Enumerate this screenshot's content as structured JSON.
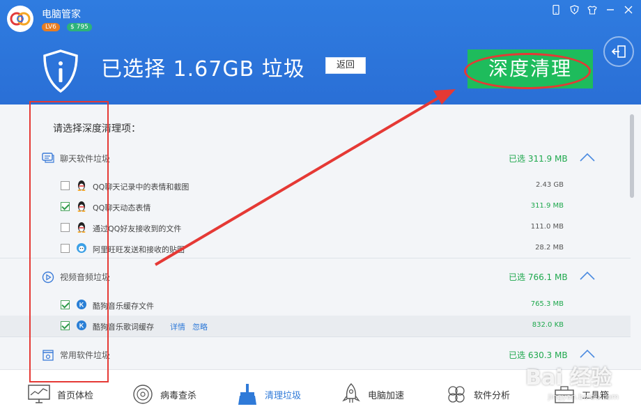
{
  "app": {
    "title": "电脑管家",
    "level": "LV6",
    "coins": "$ 795"
  },
  "window_controls": [
    "phone-icon",
    "shield-icon",
    "skin-icon",
    "minimize-icon",
    "close-icon"
  ],
  "banner": {
    "selected_text": "已选择 1.67GB 垃圾",
    "back_label": "返回",
    "deep_clean_label": "深度清理"
  },
  "content": {
    "prompt": "请选择深度清理项：",
    "sections": [
      {
        "title": "聊天软件垃圾",
        "selected": "已选 311.9 MB",
        "items": [
          {
            "label": "QQ聊天记录中的表情和截图",
            "size": "2.43 GB",
            "checked": false
          },
          {
            "label": "QQ聊天动态表情",
            "size": "311.9 MB",
            "checked": true
          },
          {
            "label": "通过QQ好友接收到的文件",
            "size": "111.0 MB",
            "checked": false
          },
          {
            "label": "阿里旺旺发送和接收的贴图",
            "size": "28.2 MB",
            "checked": false
          }
        ]
      },
      {
        "title": "视频音频垃圾",
        "selected": "已选 766.1 MB",
        "items": [
          {
            "label": "酷狗音乐缓存文件",
            "size": "765.3 MB",
            "checked": true
          },
          {
            "label": "酷狗音乐歌词缓存",
            "size": "832.0 KB",
            "checked": true,
            "detail": "详情",
            "ignore": "忽略"
          }
        ]
      },
      {
        "title": "常用软件垃圾",
        "selected": "已选 630.3 MB"
      }
    ]
  },
  "bottom_nav": [
    {
      "label": "首页体检",
      "icon": "monitor-icon"
    },
    {
      "label": "病毒查杀",
      "icon": "virus-target-icon"
    },
    {
      "label": "清理垃圾",
      "icon": "broom-icon",
      "active": true
    },
    {
      "label": "电脑加速",
      "icon": "rocket-icon"
    },
    {
      "label": "软件分析",
      "icon": "clover-icon"
    },
    {
      "label": "工具箱",
      "icon": "toolbox-icon"
    }
  ],
  "watermark": {
    "main": "Bai 经验",
    "sub": "jingyan.baidu.com"
  },
  "colors": {
    "header": "#2f7ce0",
    "green": "#1ebc5c",
    "annotation_red": "#e53935",
    "link_blue": "#2f7ad8"
  }
}
